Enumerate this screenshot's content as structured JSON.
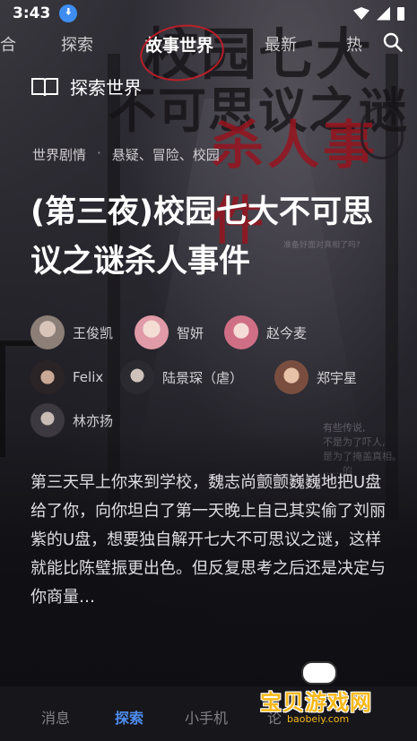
{
  "status_bar": {
    "time": "3:43",
    "download_icon": "download-icon",
    "wifi_icon": "wifi-icon",
    "signal_icon": "signal-icon",
    "battery_icon": "battery-icon"
  },
  "top_tabs": {
    "items": [
      {
        "label": "合",
        "active": false
      },
      {
        "label": "探索",
        "active": false
      },
      {
        "label": "故事世界",
        "active": true
      },
      {
        "label": "最新",
        "active": false
      },
      {
        "label": "热",
        "active": false
      }
    ],
    "search_icon": "search-icon"
  },
  "poster": {
    "title_line1": "校园七大",
    "title_line2": "不可思议之谜",
    "title_line3": "杀人事件",
    "graffiti_1": "准备好面对真相了吗?",
    "graffiti_2": "有些传说,\n不是为了吓人,\n是为了掩盖真相。\n……的"
  },
  "section": {
    "icon": "open-book-icon",
    "title": "探索世界"
  },
  "meta": {
    "category": "世界剧情",
    "separator": "·",
    "genres": "悬疑、冒险、校园"
  },
  "story": {
    "title": "(第三夜)校园七大不可思议之谜杀人事件",
    "description": "第三天早上你来到学校，魏志尚颤颤巍巍地把U盘给了你，向你坦白了第一天晚上自己其实偷了刘丽紫的U盘，想要独自解开七大不可思议之谜，这样就能比陈璧振更出色。但反复思考之后还是决定与你商量…"
  },
  "cast": [
    {
      "name": "王俊凯",
      "color": "#8c7f78"
    },
    {
      "name": "智妍",
      "color": "#e9cfc8"
    },
    {
      "name": "赵今麦",
      "color": "#f0d4d0"
    },
    {
      "name": "Felix",
      "color": "#5a4a44"
    },
    {
      "name": "陆景琛（虐）",
      "color": "#3e3a40"
    },
    {
      "name": "郑宇星",
      "color": "#b58a74"
    },
    {
      "name": "林亦扬",
      "color": "#6b6570"
    }
  ],
  "bottom_nav": {
    "items": [
      {
        "label": "消息",
        "active": false
      },
      {
        "label": "探索",
        "active": true
      },
      {
        "label": "小手机",
        "active": false
      },
      {
        "label": "论",
        "active": false
      }
    ]
  },
  "watermark": {
    "text": "宝贝游戏网",
    "url": "baobeiy.com"
  },
  "colors": {
    "accent": "#4f8ef0",
    "watermark": "#f7b81b",
    "poster_red": "#96141e",
    "background": "#0e0e12"
  }
}
